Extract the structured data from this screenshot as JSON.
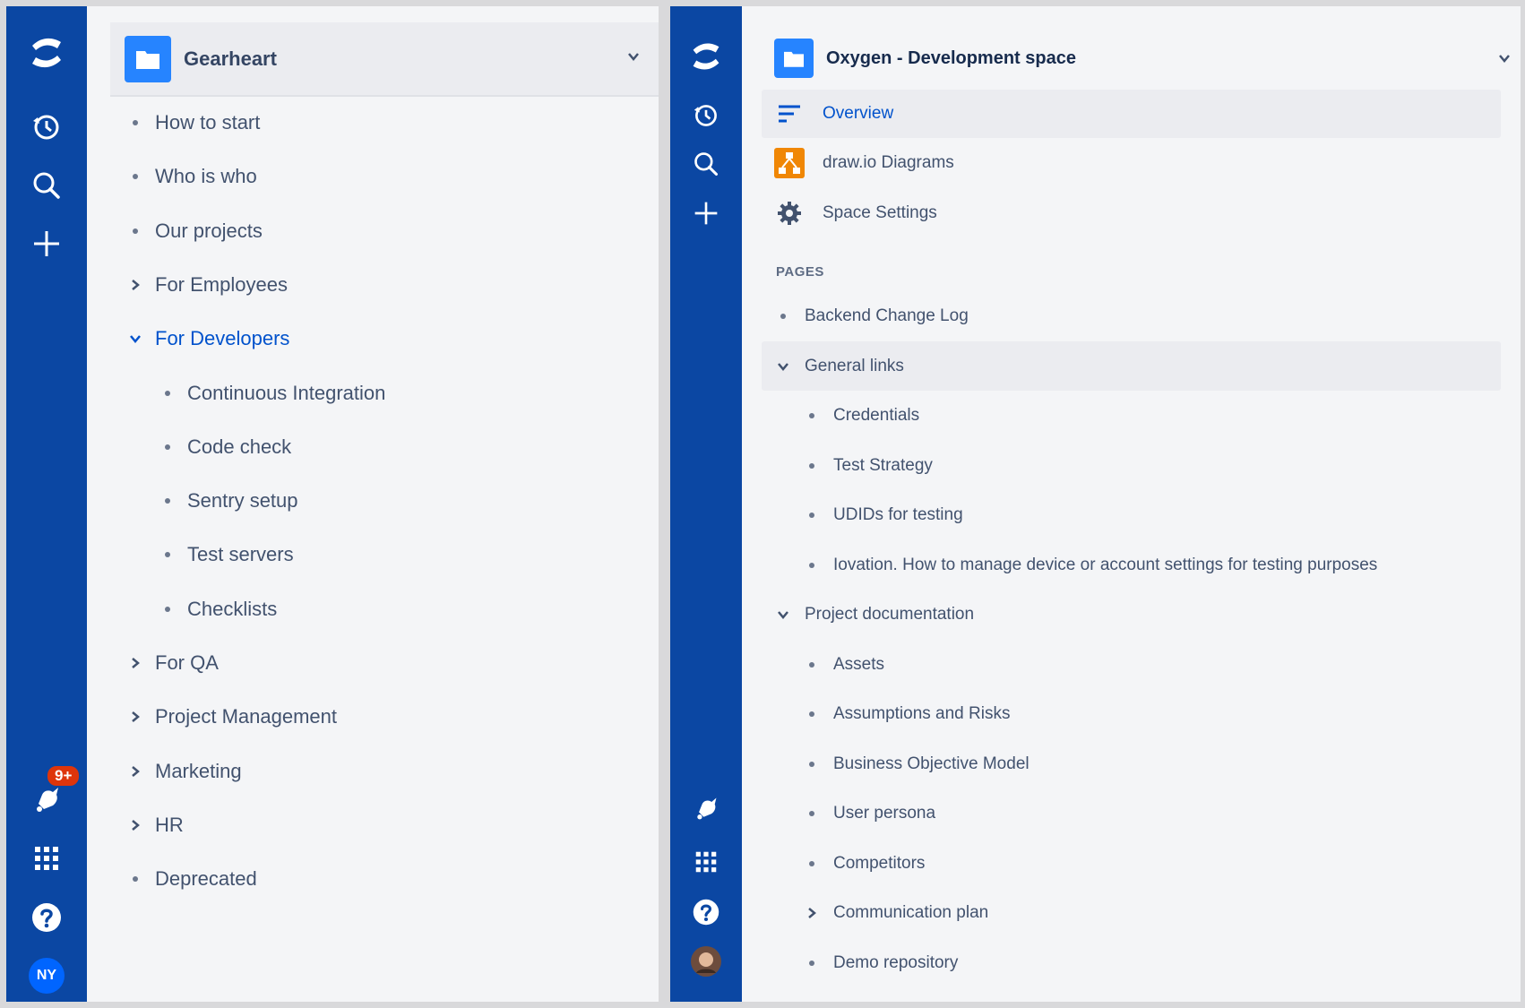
{
  "left": {
    "space_title": "Gearheart",
    "tree": [
      {
        "label": "How to start",
        "marker": "bullet"
      },
      {
        "label": "Who is who",
        "marker": "bullet"
      },
      {
        "label": "Our projects",
        "marker": "bullet"
      },
      {
        "label": "For Employees",
        "marker": "chevron-right"
      },
      {
        "label": "For Developers",
        "marker": "chevron-down",
        "active": true
      },
      {
        "label": "Continuous Integration",
        "marker": "bullet",
        "indent": 1
      },
      {
        "label": "Code check",
        "marker": "bullet",
        "indent": 1
      },
      {
        "label": "Sentry setup",
        "marker": "bullet",
        "indent": 1
      },
      {
        "label": "Test servers",
        "marker": "bullet",
        "indent": 1
      },
      {
        "label": "Checklists",
        "marker": "bullet",
        "indent": 1
      },
      {
        "label": "For QA",
        "marker": "chevron-right"
      },
      {
        "label": "Project Management",
        "marker": "chevron-right"
      },
      {
        "label": "Marketing",
        "marker": "chevron-right"
      },
      {
        "label": "HR",
        "marker": "chevron-right"
      },
      {
        "label": "Deprecated",
        "marker": "bullet"
      }
    ],
    "nav": {
      "notification_badge": "9+",
      "avatar_initials": "NY"
    }
  },
  "right": {
    "space_title": "Oxygen - Development space",
    "menu": [
      {
        "label": "Overview",
        "icon": "overview-icon"
      },
      {
        "label": "draw.io Diagrams",
        "icon": "drawio-icon"
      },
      {
        "label": "Space Settings",
        "icon": "gear-icon"
      }
    ],
    "pages_heading": "PAGES",
    "tree": [
      {
        "label": "Backend Change Log",
        "marker": "bullet"
      },
      {
        "label": "General links",
        "marker": "chevron-down",
        "selected": true
      },
      {
        "label": "Credentials",
        "marker": "bullet",
        "indent": 1
      },
      {
        "label": "Test Strategy",
        "marker": "bullet",
        "indent": 1
      },
      {
        "label": "UDIDs for testing",
        "marker": "bullet",
        "indent": 1
      },
      {
        "label": "Iovation. How to manage device or account settings for testing purposes",
        "marker": "bullet",
        "indent": 1
      },
      {
        "label": "Project documentation",
        "marker": "chevron-down"
      },
      {
        "label": "Assets",
        "marker": "bullet",
        "indent": 1
      },
      {
        "label": "Assumptions and Risks",
        "marker": "bullet",
        "indent": 1
      },
      {
        "label": "Business Objective Model",
        "marker": "bullet",
        "indent": 1
      },
      {
        "label": "User persona",
        "marker": "bullet",
        "indent": 1
      },
      {
        "label": "Competitors",
        "marker": "bullet",
        "indent": 1
      },
      {
        "label": "Communication plan",
        "marker": "chevron-right",
        "indent": 1
      },
      {
        "label": "Demo repository",
        "marker": "bullet",
        "indent": 1
      }
    ]
  },
  "colors": {
    "nav_bg": "#0b47a3",
    "sidebar_bg": "#f4f5f7",
    "active_text": "#0052cc",
    "text": "#42526e",
    "badge": "#de350b"
  }
}
